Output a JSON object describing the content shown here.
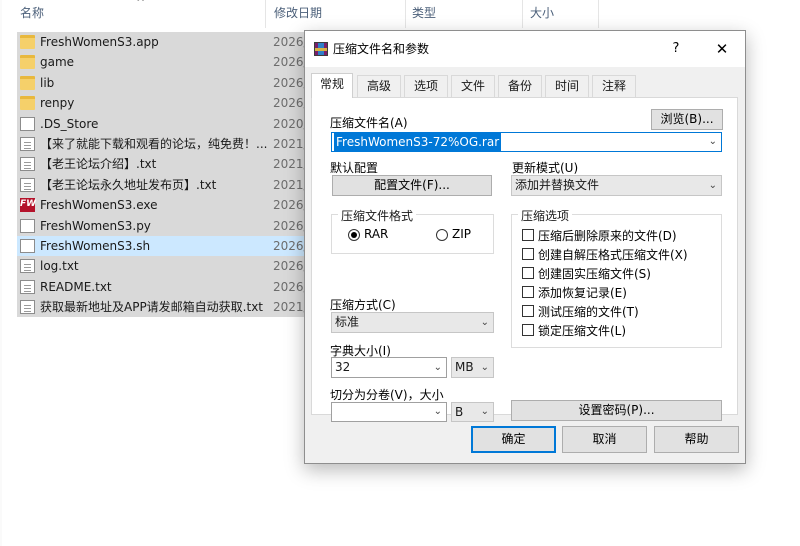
{
  "explorer": {
    "columns": {
      "name": "名称",
      "modified": "修改日期",
      "type": "类型",
      "size": "大小"
    },
    "files": [
      {
        "name": "FreshWomenS3.app",
        "date": "2026/",
        "icon": "folder-icon"
      },
      {
        "name": "game",
        "date": "2026/",
        "icon": "folder-icon"
      },
      {
        "name": "lib",
        "date": "2026/",
        "icon": "folder-icon"
      },
      {
        "name": "renpy",
        "date": "2026/",
        "icon": "folder-icon"
      },
      {
        "name": ".DS_Store",
        "date": "2020/",
        "icon": "file-icon"
      },
      {
        "name": "【来了就能下载和观看的论坛，纯免费！...",
        "date": "2021/",
        "icon": "text-file-icon"
      },
      {
        "name": "【老王论坛介绍】.txt",
        "date": "2021/",
        "icon": "text-file-icon"
      },
      {
        "name": "【老王论坛永久地址发布页】.txt",
        "date": "2021/",
        "icon": "text-file-icon"
      },
      {
        "name": "FreshWomenS3.exe",
        "date": "2026/",
        "icon": "fw-exe-icon"
      },
      {
        "name": "FreshWomenS3.py",
        "date": "2026/",
        "icon": "file-icon"
      },
      {
        "name": "FreshWomenS3.sh",
        "date": "2026/",
        "icon": "file-icon"
      },
      {
        "name": "log.txt",
        "date": "2026/",
        "icon": "text-file-icon"
      },
      {
        "name": "README.txt",
        "date": "2026/",
        "icon": "text-file-icon"
      },
      {
        "name": "获取最新地址及APP请发邮箱自动获取.txt",
        "date": "2021/",
        "icon": "text-file-icon"
      }
    ]
  },
  "dialog": {
    "title": "压缩文件名和参数",
    "help": "?",
    "close": "✕",
    "tabs": [
      "常规",
      "高级",
      "选项",
      "文件",
      "备份",
      "时间",
      "注释"
    ],
    "archive_name_label": "压缩文件名(A)",
    "browse_button": "浏览(B)...",
    "archive_name_value": "FreshWomenS3-72%OG.rar",
    "default_profile_label": "默认配置",
    "profiles_button": "配置文件(F)...",
    "update_mode_label": "更新模式(U)",
    "update_mode_value": "添加并替换文件",
    "format_group": "压缩文件格式",
    "format_rar": "RAR",
    "format_zip": "ZIP",
    "options_group": "压缩选项",
    "options": [
      "压缩后删除原来的文件(D)",
      "创建自解压格式压缩文件(X)",
      "创建固实压缩文件(S)",
      "添加恢复记录(E)",
      "测试压缩的文件(T)",
      "锁定压缩文件(L)"
    ],
    "method_label": "压缩方式(C)",
    "method_value": "标准",
    "dict_label": "字典大小(I)",
    "dict_value": "32",
    "dict_unit": "MB",
    "split_label": "切分为分卷(V)，大小",
    "split_value": "",
    "split_unit": "B",
    "password_button": "设置密码(P)...",
    "ok": "确定",
    "cancel": "取消",
    "help_button": "帮助"
  }
}
